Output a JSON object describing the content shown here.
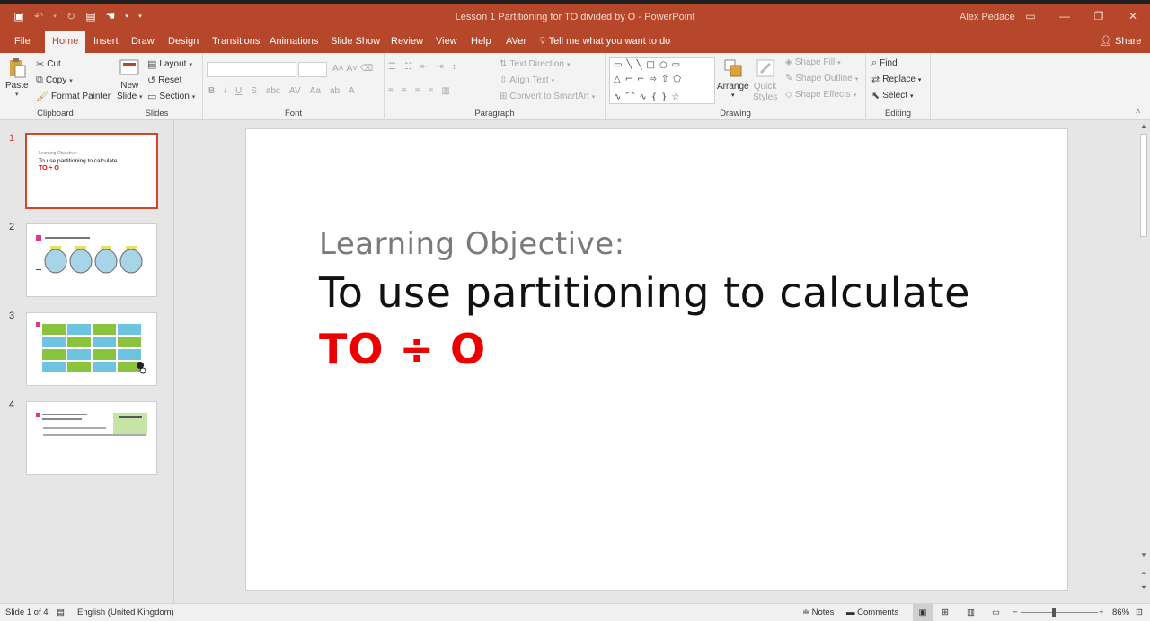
{
  "window": {
    "title": "Lesson 1 Partitioning for TO divided by O  -  PowerPoint",
    "user": "Alex Pedace"
  },
  "tabs": [
    "File",
    "Home",
    "Insert",
    "Draw",
    "Design",
    "Transitions",
    "Animations",
    "Slide Show",
    "Review",
    "View",
    "Help",
    "AVer"
  ],
  "tell_me": "Tell me what you want to do",
  "share": "Share",
  "ribbon": {
    "clipboard": {
      "label": "Clipboard",
      "paste": "Paste",
      "cut": "Cut",
      "copy": "Copy",
      "format_painter": "Format Painter"
    },
    "slides": {
      "label": "Slides",
      "new_slide": "New",
      "new_slide2": "Slide",
      "layout": "Layout",
      "reset": "Reset",
      "section": "Section"
    },
    "font": {
      "label": "Font"
    },
    "paragraph": {
      "label": "Paragraph",
      "text_direction": "Text Direction",
      "align_text": "Align Text",
      "convert_smartart": "Convert to SmartArt"
    },
    "drawing": {
      "label": "Drawing",
      "arrange": "Arrange",
      "quick_styles": "Quick",
      "quick_styles2": "Styles",
      "shape_fill": "Shape Fill",
      "shape_outline": "Shape Outline",
      "shape_effects": "Shape Effects"
    },
    "editing": {
      "label": "Editing",
      "find": "Find",
      "replace": "Replace",
      "select": "Select"
    }
  },
  "thumbnails": {
    "numbers": [
      "1",
      "2",
      "3",
      "4"
    ],
    "slide1": {
      "line1": "Learning Objective:",
      "line2": "To use partitioning to calculate",
      "line3": "TO ÷ O"
    }
  },
  "slide": {
    "label": "Learning Objective:",
    "text": "To use partitioning to calculate",
    "formula": "TO ÷ O"
  },
  "status": {
    "slide_of": "Slide 1 of 4",
    "language": "English (United Kingdom)",
    "notes": "Notes",
    "comments": "Comments",
    "zoom": "86%"
  },
  "colors": {
    "accent": "#b7472a",
    "formula": "#e00000"
  }
}
